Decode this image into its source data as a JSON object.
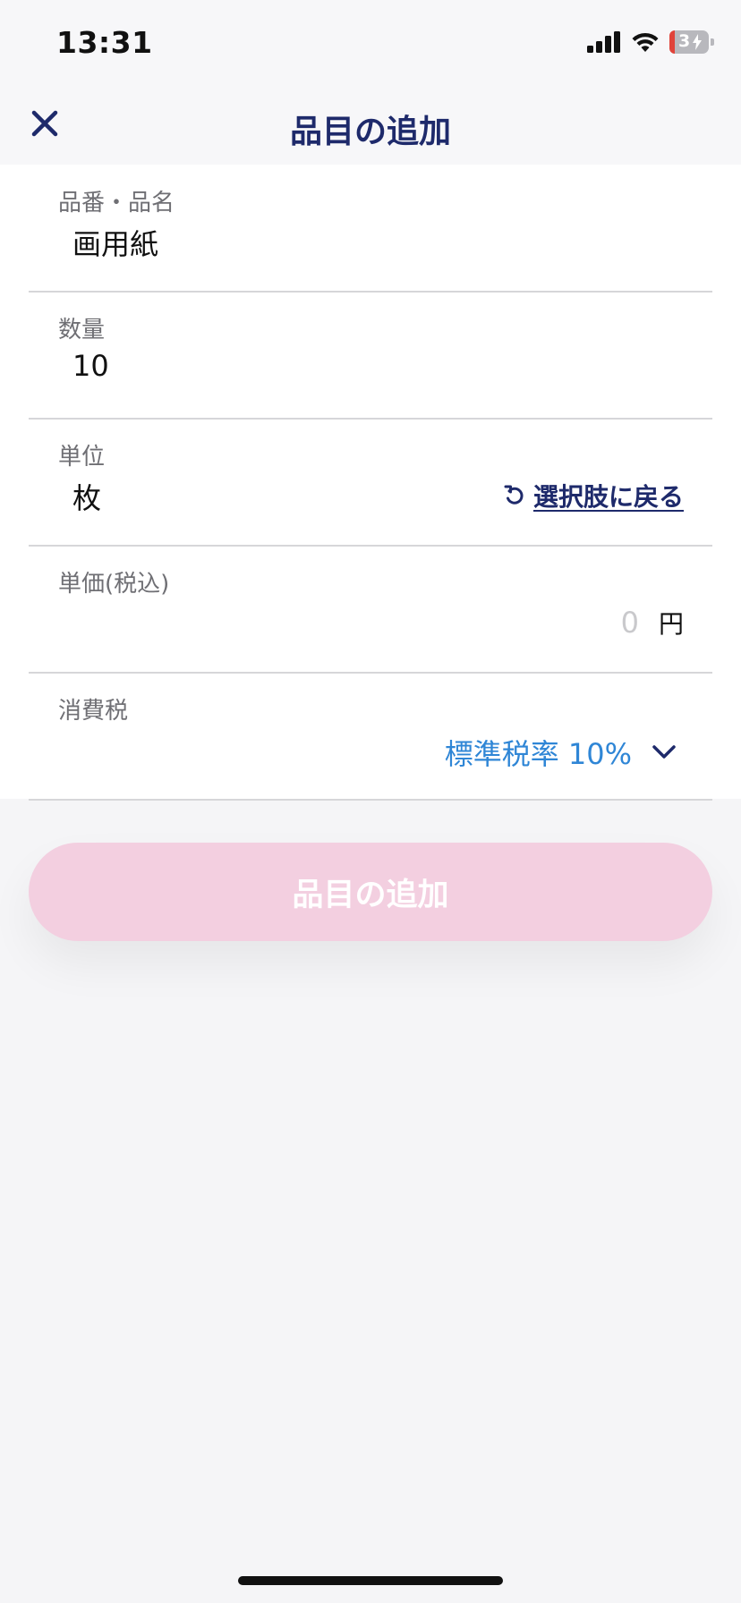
{
  "status_bar": {
    "time": "13:31",
    "battery_level": "3"
  },
  "nav": {
    "title": "品目の追加",
    "close_icon": "close-icon"
  },
  "form": {
    "item_name": {
      "label": "品番・品名",
      "value": "画用紙"
    },
    "quantity": {
      "label": "数量",
      "value": "10"
    },
    "unit": {
      "label": "単位",
      "value": "枚",
      "revert_label": "選択肢に戻る"
    },
    "unit_price": {
      "label": "単価(税込)",
      "placeholder": "0",
      "currency": "円"
    },
    "tax": {
      "label": "消費税",
      "selected": "標準税率 10%"
    }
  },
  "submit": {
    "label": "品目の追加"
  },
  "colors": {
    "accent": "#1e2a6b",
    "link_blue": "#2f86d6",
    "submit_disabled": "#f3cfe0"
  }
}
